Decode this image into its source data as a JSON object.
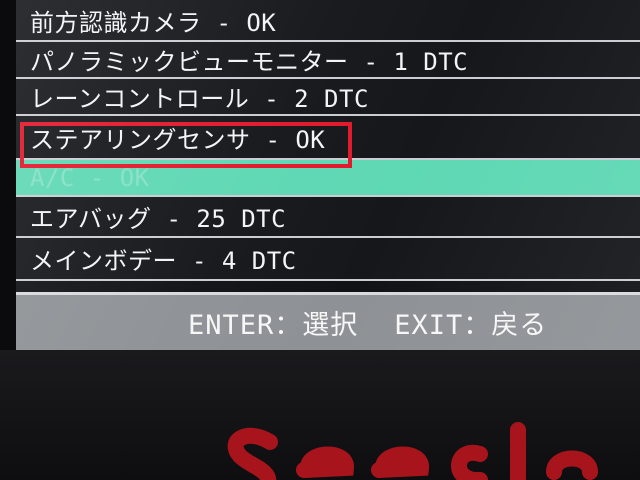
{
  "menu": {
    "items": [
      {
        "label": "前方認識カメラ - OK"
      },
      {
        "label": "パノラミックビューモニター - 1 DTC"
      },
      {
        "label": "レーンコントロール - 2 DTC"
      },
      {
        "label": "ステアリングセンサ - OK"
      },
      {
        "label": "A/C - OK"
      },
      {
        "label": "エアバッグ - 25 DTC"
      },
      {
        "label": "メインボデー - 4 DTC"
      }
    ],
    "highlighted_index": 4,
    "outlined_index": 3
  },
  "footer": {
    "enter_hint": "ENTER：選択",
    "exit_hint": "EXIT：戻る"
  },
  "colors": {
    "highlight_bg": "#5fd8b4",
    "outline": "#e2182c",
    "footer_bg": "#8e9296",
    "logo": "#a8141c"
  }
}
